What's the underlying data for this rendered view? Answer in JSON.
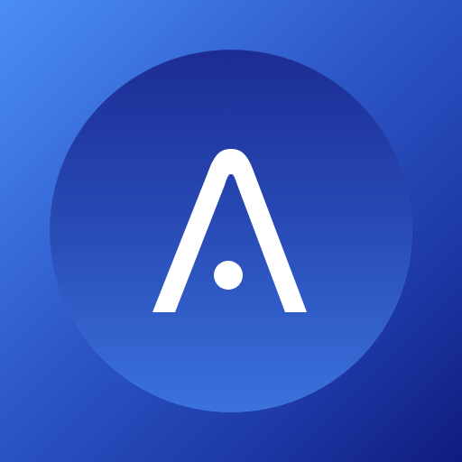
{
  "icon": {
    "name": "logo-icon",
    "colors": {
      "background_start": "#4b8ef5",
      "background_end": "#101c7e",
      "badge_top": "#1c2d95",
      "badge_bottom": "#3b72dc",
      "glyph": "#ffffff"
    }
  }
}
